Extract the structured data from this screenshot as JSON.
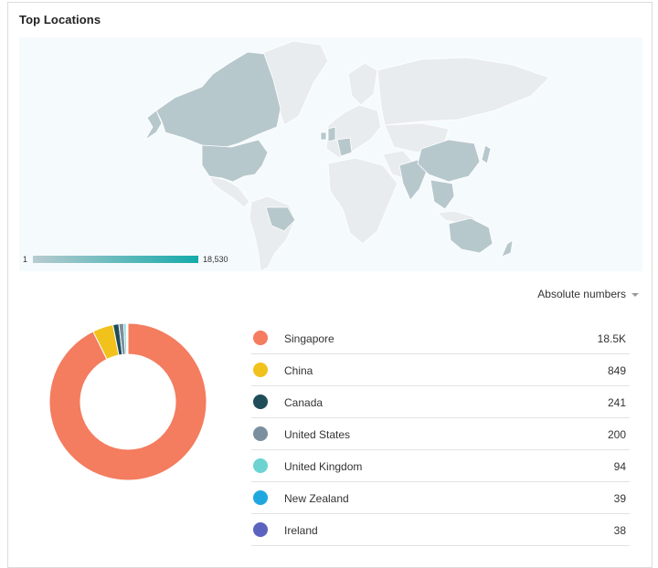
{
  "title": "Top Locations",
  "map": {
    "legend_min": "1",
    "legend_max": "18,530",
    "color_low": "#b8cbd0",
    "color_high": "#15aaaa",
    "land_color": "#e9ecee",
    "highlight_color": "#b7c8cd",
    "ocean_color": "#f5fafd"
  },
  "metric_selector": {
    "label": "Absolute numbers"
  },
  "chart_data": {
    "type": "pie",
    "style": "donut",
    "categories": [
      "Singapore",
      "China",
      "Canada",
      "United States",
      "United Kingdom",
      "New Zealand",
      "Ireland"
    ],
    "values": [
      18500,
      849,
      241,
      200,
      94,
      39,
      38
    ],
    "value_labels": [
      "18.5K",
      "849",
      "241",
      "200",
      "94",
      "39",
      "38"
    ],
    "colors": [
      "#f47c5f",
      "#f1c21b",
      "#1f4e5a",
      "#7b8f9e",
      "#6cd3d1",
      "#1fa7df",
      "#5c63bf"
    ],
    "legend_position": "right"
  }
}
